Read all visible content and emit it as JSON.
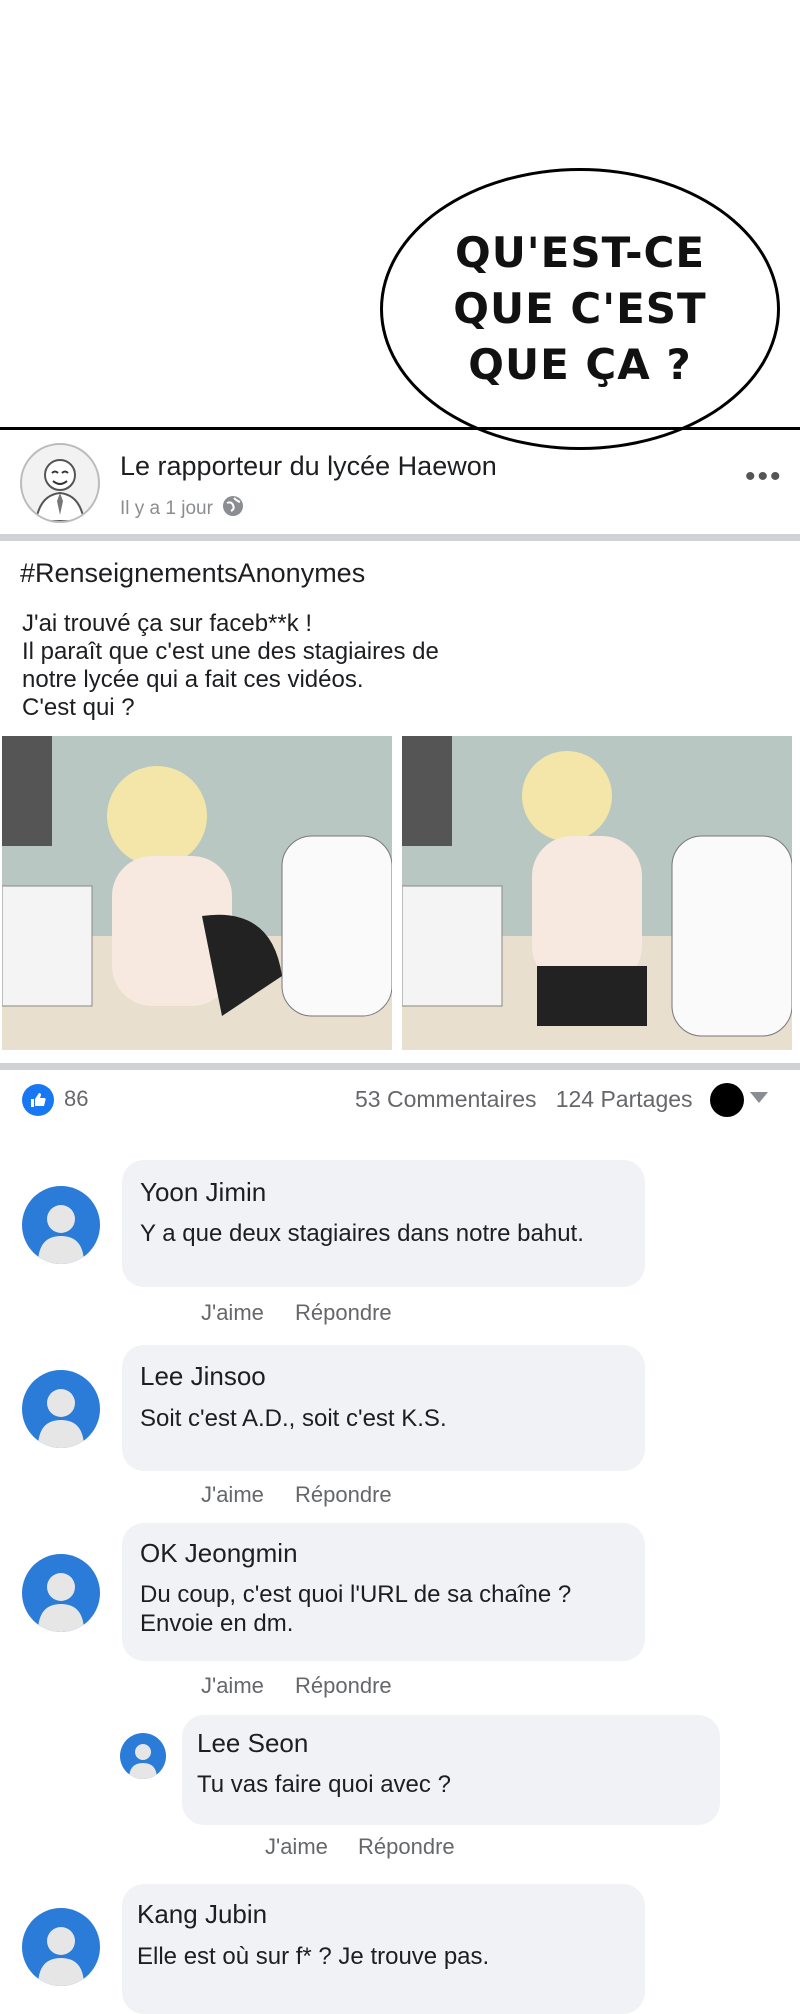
{
  "bubble": {
    "text": "QU'EST-CE\nQUE C'EST\nQUE ÇA ?"
  },
  "post": {
    "page_name": "Le rapporteur du lycée Haewon",
    "time": "Il y a 1 jour",
    "hashtag": "#RenseignementsAnonymes",
    "body": "J'ai trouvé ça sur faceb**k !\nIl paraît que c'est une des stagiaires de\nnotre lycée qui a fait ces vidéos.\nC'est qui ?"
  },
  "stats": {
    "likes": "86",
    "comments": "53 Commentaires",
    "shares": "124 Partages"
  },
  "actions": {
    "like": "J'aime",
    "reply": "Répondre"
  },
  "comments": [
    {
      "name": "Yoon Jimin",
      "text": "Y a que deux stagiaires dans notre bahut."
    },
    {
      "name": "Lee Jinsoo",
      "text": "Soit c'est A.D., soit c'est K.S."
    },
    {
      "name": "OK Jeongmin",
      "text": "Du coup, c'est quoi l'URL de sa chaîne ?\nEnvoie en dm."
    },
    {
      "name": "Lee Seon",
      "text": "Tu vas faire quoi avec ?"
    },
    {
      "name": "Kang Jubin",
      "text": "Elle est où sur f* ? Je trouve pas."
    }
  ],
  "colors": {
    "facebook_blue": "#1877f2",
    "avatar_blue": "#2b7bd8",
    "comment_bg": "#f0f2f5",
    "meta_gray": "#65676b"
  },
  "icons": [
    "globe-icon",
    "more-options-icon",
    "like-thumb-icon",
    "default-avatar-icon",
    "dropdown-caret-icon"
  ]
}
